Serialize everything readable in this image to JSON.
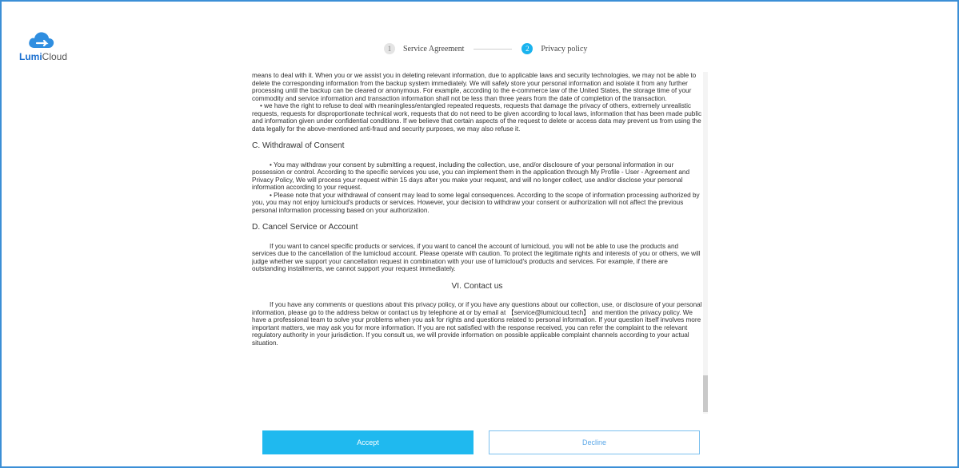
{
  "brand": {
    "logo_icon": "cloud-icon",
    "name_bold": "Lumi",
    "name_rest": "Cloud",
    "color": "#1a6fd0"
  },
  "stepper": {
    "step1_num": "1",
    "step1_label": "Service Agreement",
    "step2_num": "2",
    "step2_label": "Privacy policy",
    "active_color": "#1ab3ee"
  },
  "policy": {
    "p1": "means to deal with it. When you or we assist you in deleting relevant information, due to applicable laws and security technologies, we may not be able to delete the corresponding information from the backup system immediately. We will safely store your personal information and isolate it from any further processing until the backup can be cleared or anonymous. For example, according to the e-commerce law of the United States, the storage time of your commodity and service information and transaction information shall not be less than three years from the date of completion of the transaction.",
    "p2": "• we have the right to refuse to deal with meaningless/entangled repeated requests, requests that damage the privacy of others, extremely unrealistic requests, requests for disproportionate technical work, requests that do not need to be given according to local laws, information that has been made public and information given under confidential conditions. If we believe that certain aspects of the request to delete or access data may prevent us from using the data legally for the above-mentioned anti-fraud and security purposes, we may also refuse it.",
    "h_c": "C. Withdrawal of Consent",
    "c1": "• You may withdraw your consent by submitting a request, including the collection, use, and/or disclosure of your personal information in our possession or control. According to the specific services you use, you can implement them in the application through My Profile - User - Agreement and Privacy Policy, We will process your request within 15 days after you make your request, and will no longer collect, use and/or disclose your personal information according to your request.",
    "c2": "• Please note that your withdrawal of consent may lead to some legal consequences. According to the scope of information processing authorized by you, you may not enjoy lumicloud's products or services. However, your decision to withdraw your consent or authorization will not affect the previous personal information processing based on your authorization.",
    "h_d": "D. Cancel Service or Account",
    "d1": "If you want to cancel specific products or services, if you want to cancel the account of lumicloud, you will not be able to use the products and services due to the cancellation of the lumicloud account. Please operate with caution. To protect the legitimate rights and interests of you or others, we will judge whether we support your cancellation request in combination with your use of lumicloud's products and services. For example, if there are outstanding installments, we cannot support your request immediately.",
    "h_vi": "VI. Contact us",
    "vi1": "If you have any comments or questions about this privacy policy, or if you have any questions about our collection, use, or disclosure of your personal information, please go to the address below or contact us by telephone at or by email at 【service@lumicloud.tech】 and mention the privacy policy. We have a professional team to solve your problems when you ask for rights and questions related to personal information. If your question itself involves more important matters, we may ask you for more information. If you are not satisfied with the response received, you can refer the complaint to the relevant regulatory authority in your jurisdiction. If you consult us, we will provide information on possible applicable complaint channels according to your actual situation."
  },
  "buttons": {
    "accept": "Accept",
    "decline": "Decline",
    "accept_color": "#1fb9ef"
  }
}
